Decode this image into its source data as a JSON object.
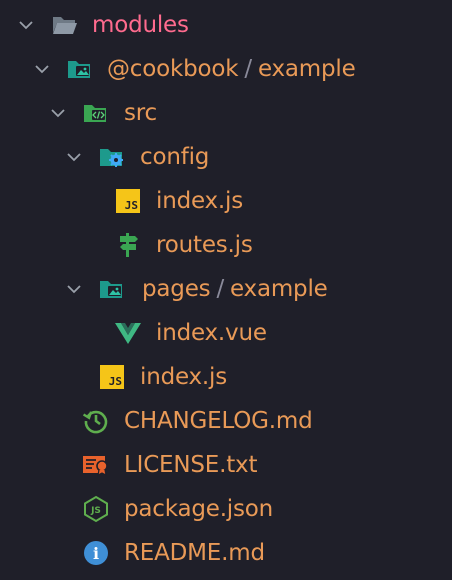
{
  "tree": {
    "modules": {
      "label": "modules"
    },
    "cookbook": {
      "scope": "@cookbook",
      "sep": "/",
      "name": "example"
    },
    "src": {
      "label": "src"
    },
    "config": {
      "label": "config"
    },
    "config_index": {
      "label": "index.js",
      "badge": "JS"
    },
    "routes": {
      "label": "routes.js"
    },
    "pages": {
      "folder": "pages",
      "sep": "/",
      "sub": "example"
    },
    "index_vue": {
      "label": "index.vue"
    },
    "src_index": {
      "label": "index.js",
      "badge": "JS"
    },
    "changelog": {
      "label": "CHANGELOG.md"
    },
    "license": {
      "label": "LICENSE.txt"
    },
    "package": {
      "label": "package.json",
      "badge": "JS"
    },
    "readme": {
      "label": "README.md",
      "badge": "i"
    }
  },
  "colors": {
    "background": "#1f1f29",
    "text": "#e99a57",
    "folder_root_text": "#ff6b8e",
    "separator": "#8a8a9a",
    "chevron": "#9aa0aa",
    "folder_teal": "#1d9a8c",
    "js_badge": "#f5c518",
    "vue_green": "#3fb883",
    "changelog_green": "#5fae4e",
    "license_orange": "#e8622c",
    "readme_blue": "#3f8fd6",
    "gear_blue": "#3fa9f5",
    "src_green": "#3aa652"
  }
}
